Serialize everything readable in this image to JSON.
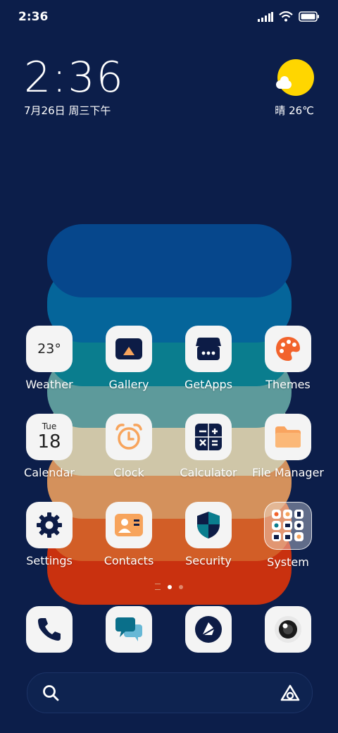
{
  "status_bar": {
    "time": "2:36"
  },
  "clock_widget": {
    "time": "2:36",
    "date": "7月26日 周三下午"
  },
  "weather_widget": {
    "text": "晴 26℃",
    "icon": "sunny-cloud-icon"
  },
  "apps": [
    {
      "label": "Weather",
      "icon": "weather-icon",
      "icon_text": "23°"
    },
    {
      "label": "Gallery",
      "icon": "gallery-icon"
    },
    {
      "label": "GetApps",
      "icon": "getapps-icon"
    },
    {
      "label": "Themes",
      "icon": "palette-icon"
    },
    {
      "label": "Calendar",
      "icon": "calendar-icon",
      "day": "Tue",
      "date": "18"
    },
    {
      "label": "Clock",
      "icon": "alarm-clock-icon"
    },
    {
      "label": "Calculator",
      "icon": "calculator-icon"
    },
    {
      "label": "File Manager",
      "icon": "folder-icon"
    },
    {
      "label": "Settings",
      "icon": "gear-icon"
    },
    {
      "label": "Contacts",
      "icon": "contact-card-icon"
    },
    {
      "label": "Security",
      "icon": "shield-icon"
    },
    {
      "label": "System",
      "icon": "folder-grid-icon"
    }
  ],
  "dock": [
    {
      "icon": "phone-icon"
    },
    {
      "icon": "messages-icon"
    },
    {
      "icon": "browser-icon"
    },
    {
      "icon": "camera-icon"
    }
  ],
  "page_indicator": {
    "pages": 2,
    "current": 1
  },
  "search_bar": {
    "icon": "search-icon",
    "assistant_icon": "assistant-icon"
  },
  "colors": {
    "background": "#0c1e4a",
    "stripes": [
      "#c9310f",
      "#d25e27",
      "#d4915c",
      "#cfc6a8",
      "#5d9a9b",
      "#0a7d8e",
      "#05659a",
      "#06478c"
    ]
  }
}
